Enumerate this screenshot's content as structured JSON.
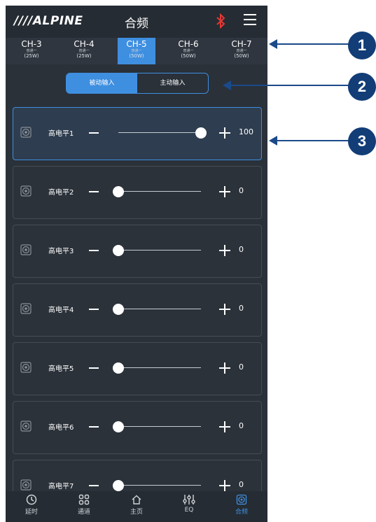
{
  "header": {
    "logo": "////ALPINE",
    "title": "合频"
  },
  "channels": [
    {
      "name": "CH-3",
      "sub": "普通一",
      "power": "(25W)",
      "selected": false
    },
    {
      "name": "CH-4",
      "sub": "普通一",
      "power": "(25W)",
      "selected": false
    },
    {
      "name": "CH-5",
      "sub": "普通一",
      "power": "(50W)",
      "selected": true
    },
    {
      "name": "CH-6",
      "sub": "普通一",
      "power": "(50W)",
      "selected": false
    },
    {
      "name": "CH-7",
      "sub": "普通一",
      "power": "(50W)",
      "selected": false
    }
  ],
  "input_toggle": {
    "passive_label": "被动输入",
    "active_label": "主动输入",
    "selected": "passive"
  },
  "rows": [
    {
      "label": "高电平1",
      "value": "100",
      "level": 1.0,
      "active": true
    },
    {
      "label": "高电平2",
      "value": "0",
      "level": 0.0,
      "active": false
    },
    {
      "label": "高电平3",
      "value": "0",
      "level": 0.0,
      "active": false
    },
    {
      "label": "高电平4",
      "value": "0",
      "level": 0.0,
      "active": false
    },
    {
      "label": "高电平5",
      "value": "0",
      "level": 0.0,
      "active": false
    },
    {
      "label": "高电平6",
      "value": "0",
      "level": 0.0,
      "active": false
    },
    {
      "label": "高电平7",
      "value": "0",
      "level": 0.0,
      "active": false
    }
  ],
  "bottom_nav": [
    {
      "label": "延时",
      "icon": "clock-icon",
      "selected": false
    },
    {
      "label": "通道",
      "icon": "grid-icon",
      "selected": false
    },
    {
      "label": "主页",
      "icon": "home-icon",
      "selected": false
    },
    {
      "label": "EQ",
      "icon": "eq-sliders-icon",
      "selected": false
    },
    {
      "label": "合频",
      "icon": "speaker-icon",
      "selected": true
    }
  ],
  "annotations": [
    "1",
    "2",
    "3"
  ],
  "colors": {
    "accent": "#3f8fe0",
    "background": "#2a3139",
    "annotation": "#123d77"
  }
}
